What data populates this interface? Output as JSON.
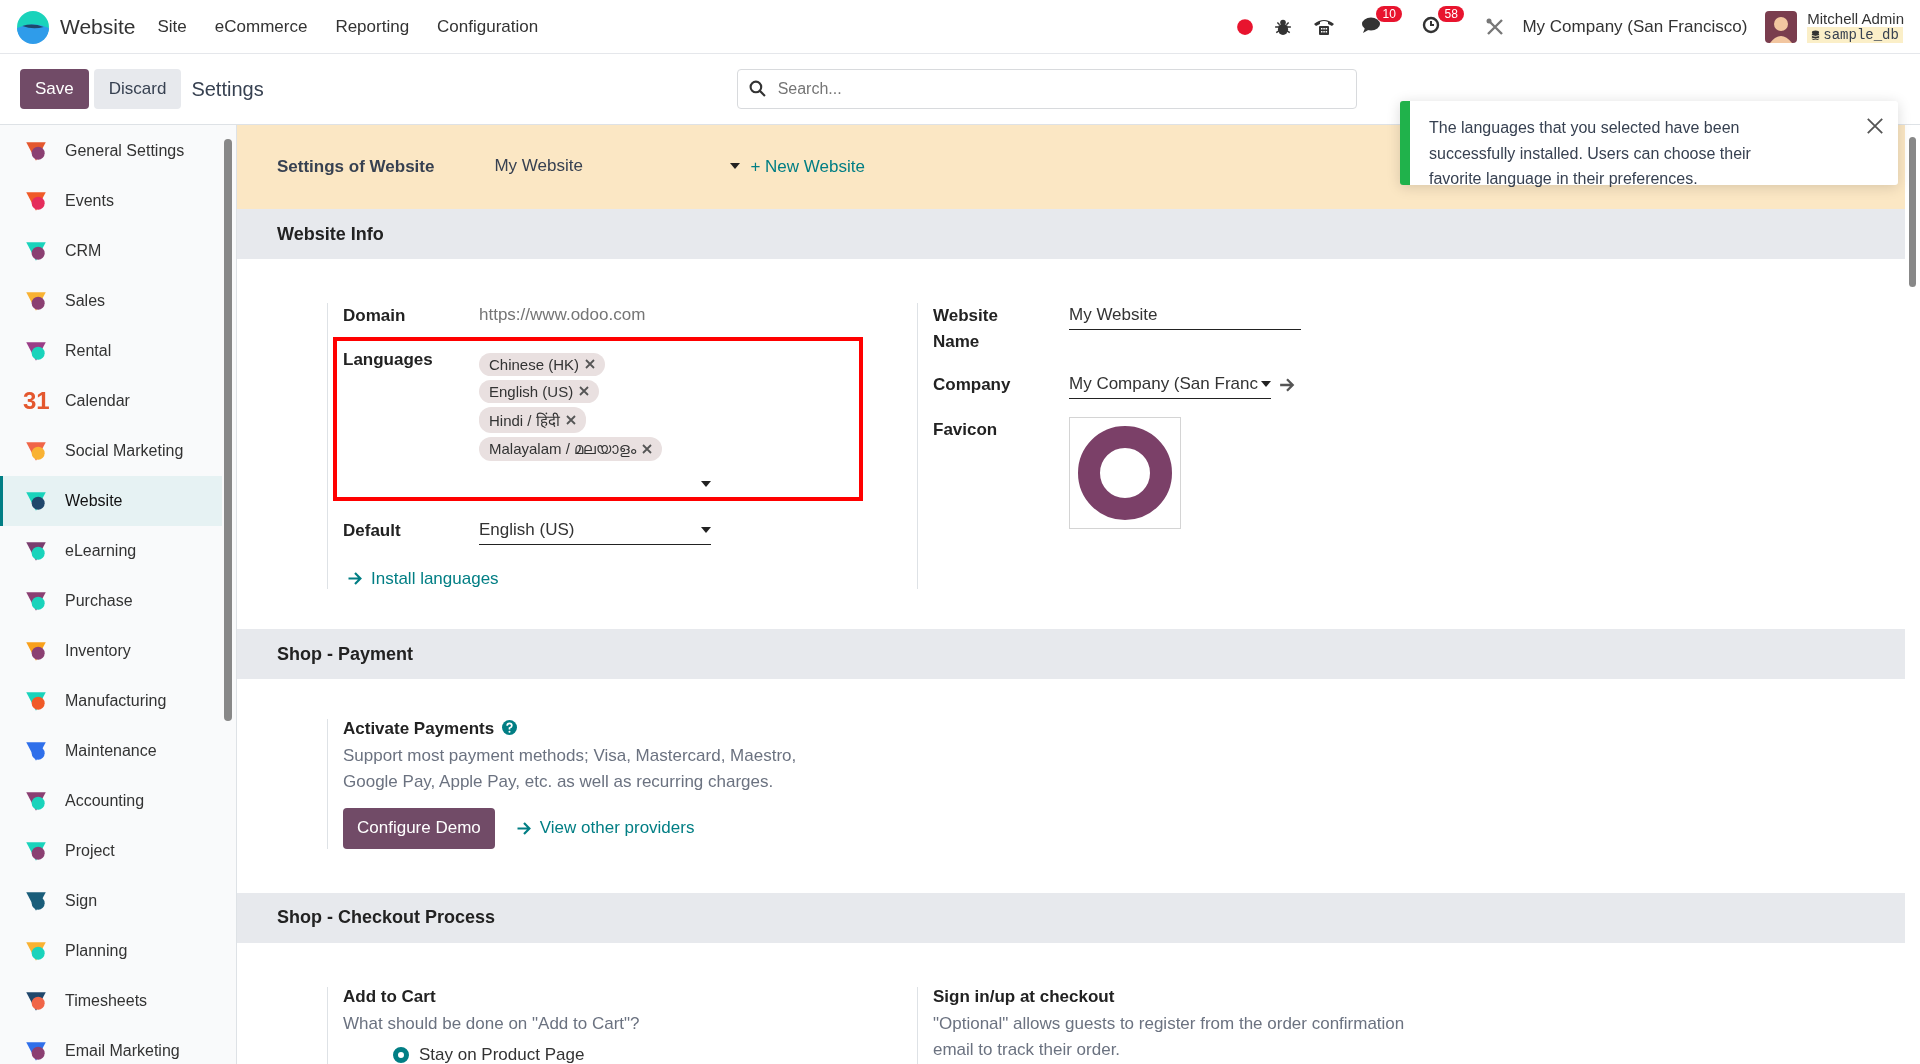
{
  "navbar": {
    "app_name": "Website",
    "menu": [
      "Site",
      "eCommerce",
      "Reporting",
      "Configuration"
    ],
    "messages_badge": "10",
    "activities_badge": "58",
    "company": "My Company (San Francisco)",
    "user": "Mitchell Admin",
    "database": "sample_db"
  },
  "control_panel": {
    "buttons": [
      {
        "label": "Save",
        "kind": "primary"
      },
      {
        "label": "Discard",
        "kind": "secondary"
      }
    ],
    "breadcrumb": "Settings",
    "search": {
      "placeholder": "Search..."
    }
  },
  "sidebar": {
    "items": [
      {
        "label": "General Settings",
        "selected": false
      },
      {
        "label": "Events",
        "selected": false
      },
      {
        "label": "CRM",
        "selected": false
      },
      {
        "label": "Sales",
        "selected": false
      },
      {
        "label": "Rental",
        "selected": false
      },
      {
        "label": "Calendar",
        "selected": false,
        "icon_text": "31"
      },
      {
        "label": "Social Marketing",
        "selected": false
      },
      {
        "label": "Website",
        "selected": true
      },
      {
        "label": "eLearning",
        "selected": false
      },
      {
        "label": "Purchase",
        "selected": false
      },
      {
        "label": "Inventory",
        "selected": false
      },
      {
        "label": "Manufacturing",
        "selected": false
      },
      {
        "label": "Maintenance",
        "selected": false
      },
      {
        "label": "Accounting",
        "selected": false
      },
      {
        "label": "Project",
        "selected": false
      },
      {
        "label": "Sign",
        "selected": false
      },
      {
        "label": "Planning",
        "selected": false
      },
      {
        "label": "Timesheets",
        "selected": false
      },
      {
        "label": "Email Marketing",
        "selected": false
      }
    ]
  },
  "website_bar": {
    "label": "Settings of Website",
    "value": "My Website",
    "new_button": "+ New Website"
  },
  "website_info": {
    "title": "Website Info",
    "domain": {
      "label": "Domain",
      "placeholder": "https://www.odoo.com"
    },
    "languages": {
      "label": "Languages",
      "tags": [
        "Chinese (HK)",
        "English (US)",
        "Hindi / हिंदी",
        "Malayalam / മലയാളം"
      ]
    },
    "default": {
      "label": "Default",
      "value": "English (US)"
    },
    "install_link": "Install languages",
    "website_name": {
      "label": "Website Name",
      "value": "My Website"
    },
    "company": {
      "label": "Company",
      "value": "My Company (San Franc"
    },
    "favicon": {
      "label": "Favicon"
    }
  },
  "shop_payment": {
    "title": "Shop - Payment",
    "setting": "Activate Payments",
    "description": "Support most payment methods; Visa, Mastercard, Maestro, Google Pay, Apple Pay, etc. as well as recurring charges.",
    "button": "Configure Demo",
    "link": "View other providers"
  },
  "shop_checkout": {
    "title": "Shop - Checkout Process",
    "add_to_cart": {
      "title": "Add to Cart",
      "description": "What should be done on \"Add to Cart\"?",
      "options": [
        {
          "label": "Stay on Product Page",
          "selected": true
        }
      ]
    },
    "sign_in": {
      "title": "Sign in/up at checkout",
      "description": "\"Optional\" allows guests to register from the order confirmation email to track their order."
    }
  },
  "notification": {
    "message": "The languages that you selected have been successfully installed. Users can choose their favorite language in their preferences."
  }
}
